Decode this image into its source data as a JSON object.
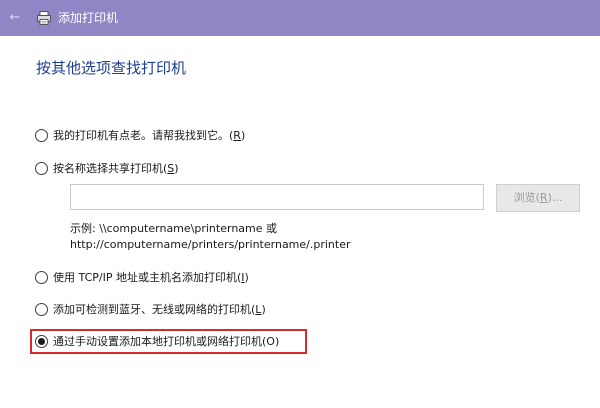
{
  "window": {
    "title": "添加打印机",
    "back_icon": "back-arrow-icon",
    "app_icon": "printer-icon",
    "title_bar_color": "#8f86c6"
  },
  "page": {
    "heading": "按其他选项查找打印机"
  },
  "options": [
    {
      "text": "我的打印机有点老。请帮我找到它。(",
      "key": "R",
      "suffix": ")",
      "checked": false
    },
    {
      "text": "按名称选择共享打印机(",
      "key": "S",
      "suffix": ")",
      "checked": false
    },
    {
      "text": "使用 TCP/IP 地址或主机名添加打印机(",
      "key": "I",
      "suffix": ")",
      "checked": false
    },
    {
      "text": "添加可检测到蓝牙、无线或网络的打印机(",
      "key": "L",
      "suffix": ")",
      "checked": false
    },
    {
      "text": "通过手动设置添加本地打印机或网络打印机(O)",
      "checked": true
    }
  ],
  "share_field": {
    "value": ""
  },
  "browse_button": {
    "label_prefix": "浏览(",
    "key": "R",
    "label_suffix": ")..."
  },
  "example": {
    "line1": "示例: \\\\computername\\printername 或",
    "line2": "http://computername/printers/printername/.printer"
  },
  "highlight_color": "#d92b2b"
}
